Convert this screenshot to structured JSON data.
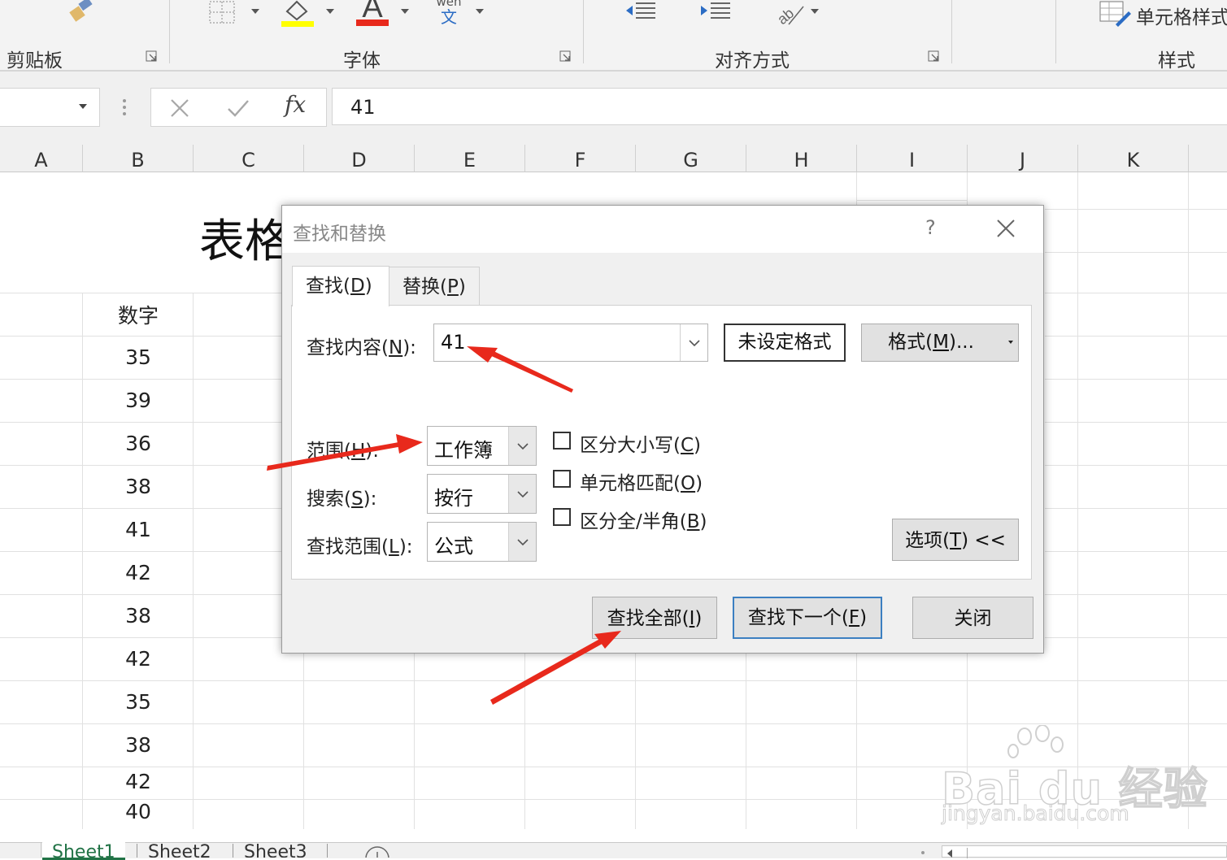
{
  "ribbon": {
    "groups": [
      {
        "label": "剪贴板"
      },
      {
        "label": "字体"
      },
      {
        "label": "对齐方式"
      },
      {
        "label": "样式"
      }
    ],
    "cell_styles_label": "单元格样式",
    "phonetic_label": "wén",
    "phonetic_char": "文",
    "font_color_letter": "A"
  },
  "formula_bar": {
    "name_box": "",
    "fx_label": "fx",
    "value": "41"
  },
  "columns": [
    "A",
    "B",
    "C",
    "D",
    "E",
    "F",
    "G",
    "H",
    "I",
    "J",
    "K"
  ],
  "sheet": {
    "title_partial": "表格",
    "header_cell": "数字",
    "values": [
      "35",
      "39",
      "36",
      "38",
      "41",
      "42",
      "38",
      "42",
      "35",
      "38",
      "42",
      "40"
    ]
  },
  "sheet_tabs": [
    "Sheet1",
    "Sheet2",
    "Sheet3"
  ],
  "dialog": {
    "title": "查找和替换",
    "help": "?",
    "tabs": [
      {
        "text": "查找(",
        "key": "D",
        "close": ")"
      },
      {
        "text": "替换(",
        "key": "P",
        "close": ")"
      }
    ],
    "find_what_label": {
      "text": "查找内容(",
      "key": "N",
      "close": "):"
    },
    "find_what_value": "41",
    "no_format_label": "未设定格式",
    "format_button": {
      "text": "格式(",
      "key": "M",
      "close": ")..."
    },
    "within": {
      "label": {
        "text": "范围(",
        "key": "H",
        "close": "):"
      },
      "value": "工作簿"
    },
    "search": {
      "label": {
        "text": "搜索(",
        "key": "S",
        "close": "):"
      },
      "value": "按行"
    },
    "look_in": {
      "label": {
        "text": "查找范围(",
        "key": "L",
        "close": "):"
      },
      "value": "公式"
    },
    "match_case": {
      "text": "区分大小写(",
      "key": "C",
      "close": ")",
      "checked": false
    },
    "match_entire": {
      "text": "单元格匹配(",
      "key": "O",
      "close": ")",
      "checked": false
    },
    "match_byte": {
      "text": "区分全/半角(",
      "key": "B",
      "close": ")",
      "checked": false
    },
    "options_button": {
      "text": "选项(",
      "key": "T",
      "close": ") <<"
    },
    "find_all": {
      "text": "查找全部(",
      "key": "I",
      "close": ")"
    },
    "find_next": {
      "text": "查找下一个(",
      "key": "F",
      "close": ")"
    },
    "close_button": "关闭"
  },
  "watermark": {
    "text": "Bai du 经验",
    "url": "jingyan.baidu.com"
  },
  "colors": {
    "accent_red": "#e8291c",
    "excel_green": "#217346",
    "focus_blue": "#3c7fc1"
  }
}
